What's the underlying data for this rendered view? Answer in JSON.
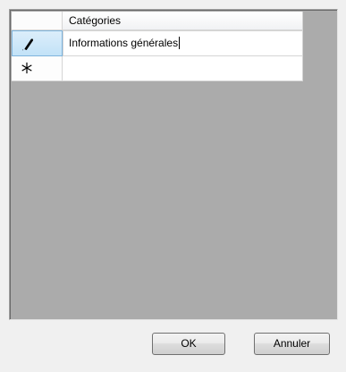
{
  "grid": {
    "column_header": "Catégories",
    "rows": [
      {
        "indicator_icon": "pencil-icon",
        "value": "Informations générales",
        "state": "editing"
      },
      {
        "indicator_icon": "new-row-asterisk-icon",
        "value": "",
        "state": "new-row"
      }
    ]
  },
  "buttons": {
    "ok_label": "OK",
    "cancel_label": "Annuler"
  },
  "colors": {
    "window_background": "#f0f0f0",
    "grid_background": "#ababab",
    "selected_row_header": "#c2e2f7"
  }
}
